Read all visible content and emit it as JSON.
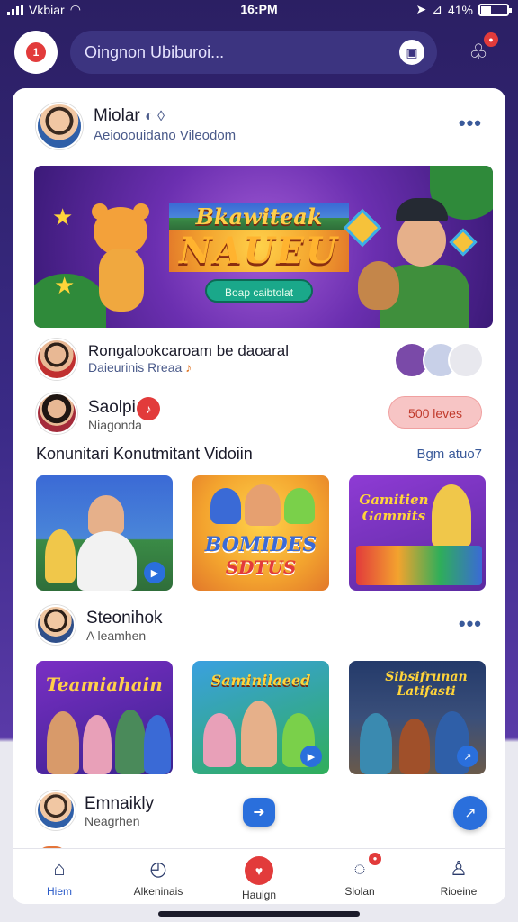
{
  "status_bar": {
    "carrier": "Vkbiar",
    "time": "16:PM",
    "battery": "41%",
    "battery_level": 0.41
  },
  "top_bar": {
    "search_text": "Oingnon Ubiburoi..."
  },
  "post": {
    "author": "Miolar",
    "subtitle": "Aeiooouidano Vileodom",
    "banner": {
      "title_line1": "Bkawiteak",
      "title_line2": "NAUEU",
      "button": "Boap caibtolat"
    }
  },
  "feed_row1": {
    "title": "Rongalookcaroam be daoaral",
    "subtitle": "Daieurinis Rreaa"
  },
  "feed_row2": {
    "name": "Saolpi",
    "subtitle": "Niagonda",
    "pill": "500 leves"
  },
  "section": {
    "title": "Konunitari Konutmitant Vidoiin",
    "link": "Bgm atuo7",
    "thumbs": [
      {
        "label": ""
      },
      {
        "label_line1": "BOMIDES",
        "label_line2": "SDTUS"
      },
      {
        "label": "Gamitien Gamnits"
      }
    ]
  },
  "post2": {
    "name": "Steonihok",
    "subtitle": "A leamhen",
    "thumbs": [
      {
        "label": "Teamiahain"
      },
      {
        "label": "Saminilaeed"
      },
      {
        "label": "Sibsifrunan Latifasti"
      }
    ]
  },
  "post3": {
    "name": "Emnaikly",
    "subtitle": "Neagrhen"
  },
  "bottom_nav": [
    {
      "label": "Hiem",
      "icon": "home-icon"
    },
    {
      "label": "Alkeninais",
      "icon": "clock-icon"
    },
    {
      "label": "Hauign",
      "icon": "heart-music-icon"
    },
    {
      "label": "Slolan",
      "icon": "chat-icon"
    },
    {
      "label": "Rioeine",
      "icon": "profile-icon"
    }
  ]
}
